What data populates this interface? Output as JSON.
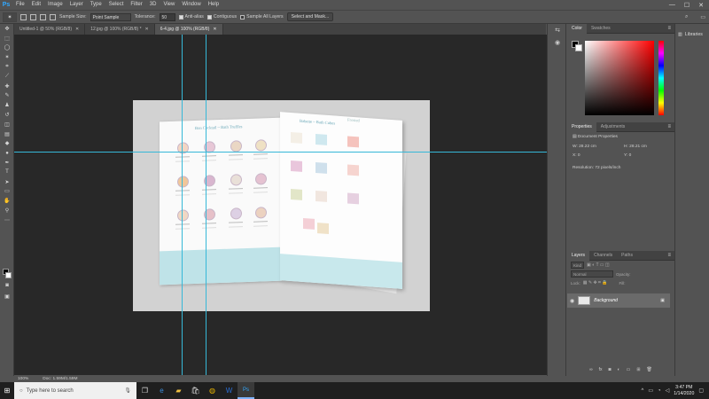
{
  "app": {
    "logo": "Ps"
  },
  "menu": [
    "File",
    "Edit",
    "Image",
    "Layer",
    "Type",
    "Select",
    "Filter",
    "3D",
    "View",
    "Window",
    "Help"
  ],
  "window_controls": {
    "minimize": "—",
    "maximize": "☐",
    "close": "✕"
  },
  "options": {
    "sample_size_label": "Sample Size:",
    "sample_size_value": "Point Sample",
    "tolerance_label": "Tolerance:",
    "tolerance_value": "50",
    "anti_alias_label": "Anti-alias",
    "contiguous_label": "Contiguous",
    "sample_all_label": "Sample All Layers",
    "select_mask_label": "Select and Mask..."
  },
  "tabs": [
    {
      "label": "Untitled-1 @ 50% (RGB/8)",
      "active": false
    },
    {
      "label": "12.jpg @ 100% (RGB/8) *",
      "active": false
    },
    {
      "label": "6-4.jpg @ 100% (RGB/8)",
      "active": true
    }
  ],
  "status": {
    "zoom": "100%",
    "doc": "Doc: 1.59M/1.59M"
  },
  "brochure": {
    "left_title": "Bon Cocktail ~ Bath Truffles",
    "right_title": "Babette ~ Bath Cubes",
    "right_subtitle": "Frosted"
  },
  "color_panel": {
    "tabs": [
      "Color",
      "Swatches"
    ]
  },
  "libraries_label": "Libraries",
  "properties": {
    "tabs": [
      "Properties",
      "Adjustments"
    ],
    "heading": "Document Properties",
    "w_label": "W:",
    "w_value": "28.22 cm",
    "h_label": "H:",
    "h_value": "28.21 cm",
    "x_label": "X:",
    "x_value": "0",
    "y_label": "Y:",
    "y_value": "0",
    "resolution": "Resolution: 72 pixels/inch"
  },
  "layers": {
    "tabs": [
      "Layers",
      "Channels",
      "Paths"
    ],
    "kind": "Kind",
    "blend": "Normal",
    "opacity_label": "Opacity:",
    "lock_label": "Lock:",
    "fill_label": "Fill:",
    "layer_name": "Background"
  },
  "taskbar": {
    "search_placeholder": "Type here to search",
    "time": "3:47 PM",
    "date": "1/14/2020"
  }
}
